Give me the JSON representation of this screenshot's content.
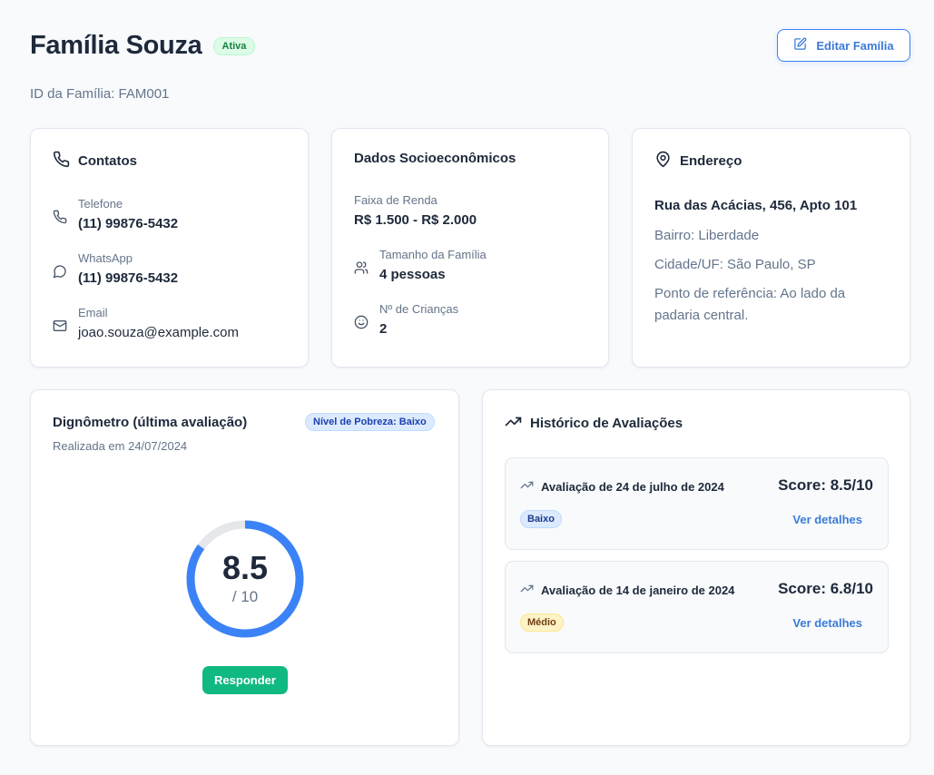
{
  "header": {
    "title": "Família Souza",
    "status": "Ativa",
    "family_id": "ID da Família: FAM001",
    "edit_label": "Editar Família"
  },
  "contacts": {
    "title": "Contatos",
    "phone_label": "Telefone",
    "phone": "(11) 99876-5432",
    "whatsapp_label": "WhatsApp",
    "whatsapp": "(11) 99876-5432",
    "email_label": "Email",
    "email": "joao.souza@example.com"
  },
  "socio": {
    "title": "Dados Socioeconômicos",
    "income_label": "Faixa de Renda",
    "income": "R$ 1.500 - R$ 2.000",
    "size_label": "Tamanho da Família",
    "size": "4 pessoas",
    "children_label": "Nº de Crianças",
    "children": "2"
  },
  "address": {
    "title": "Endereço",
    "street": "Rua das Acácias, 456, Apto 101",
    "district": "Bairro: Liberdade",
    "city": "Cidade/UF: São Paulo, SP",
    "reference": "Ponto de referência: Ao lado da padaria central."
  },
  "gauge": {
    "title": "Dignômetro (última avaliação)",
    "level": "Nível de Pobreza: Baixo",
    "date": "Realizada em 24/07/2024",
    "score": "8.5",
    "max": "/ 10",
    "score_value": 8.5,
    "max_value": 10,
    "color": "#3b82f6",
    "track_color": "#e5e7eb",
    "action": "Responder"
  },
  "history": {
    "title": "Histórico de Avaliações",
    "items": [
      {
        "title": "Avaliação de 24 de julho de 2024",
        "score": "Score: 8.5/10",
        "level": "Baixo",
        "link": "Ver detalhes"
      },
      {
        "title": "Avaliação de 14 de janeiro de 2024",
        "score": "Score: 6.8/10",
        "level": "Médio",
        "link": "Ver detalhes"
      }
    ]
  },
  "icons": [
    "phone-icon",
    "message-circle-icon",
    "mail-icon",
    "users-icon",
    "smile-icon",
    "map-pin-icon",
    "pencil-square-icon",
    "trending-up-icon"
  ]
}
